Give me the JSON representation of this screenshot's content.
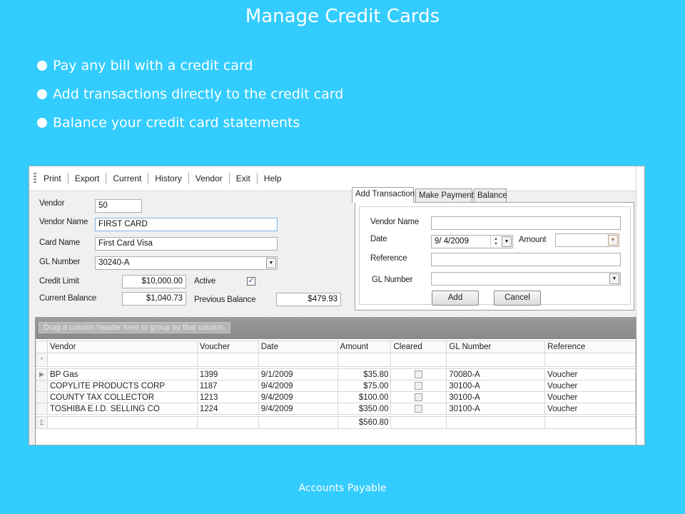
{
  "slide": {
    "title": "Manage Credit Cards",
    "bullets": [
      "Pay any bill with a credit card",
      "Add transactions directly to the credit card",
      "Balance your credit card statements"
    ],
    "footer": "Accounts Payable"
  },
  "menu": [
    "Print",
    "Export",
    "Current",
    "History",
    "Vendor",
    "Exit",
    "Help"
  ],
  "vendor_form": {
    "vendor_label": "Vendor",
    "vendor_value": "50",
    "vendor_name_label": "Vendor Name",
    "vendor_name_value": "FIRST CARD",
    "card_name_label": "Card Name",
    "card_name_value": "First Card Visa",
    "gl_number_label": "GL Number",
    "gl_number_value": "30240-A",
    "credit_limit_label": "Credit Limit",
    "credit_limit_value": "$10,000.00",
    "active_label": "Active",
    "active_checked": true,
    "active_mark": "✓",
    "current_balance_label": "Current Balance",
    "current_balance_value": "$1,040.73",
    "previous_balance_label": "Previous Balance",
    "previous_balance_value": "$479.93"
  },
  "tabs": [
    {
      "label": "Add Transaction",
      "active": true
    },
    {
      "label": "Make Payment",
      "active": false
    },
    {
      "label": "Balance",
      "active": false
    }
  ],
  "transaction_form": {
    "vendor_name_label": "Vendor Name",
    "vendor_name_value": "",
    "date_label": "Date",
    "date_value": "9/ 4/2009",
    "amount_label": "Amount",
    "amount_value": "",
    "reference_label": "Reference",
    "reference_value": "",
    "gl_number_label": "GL Number",
    "gl_number_value": "",
    "add_button": "Add",
    "cancel_button": "Cancel"
  },
  "grid": {
    "group_hint": "Drag a column header here to group by that column.",
    "columns": [
      "Vendor",
      "Voucher",
      "Date",
      "Amount",
      "Cleared",
      "GL Number",
      "Reference"
    ],
    "new_row_marker": "*",
    "rows": [
      {
        "vendor": "BP Gas",
        "voucher": "1399",
        "date": "9/1/2009",
        "amount": "$35.80",
        "cleared": false,
        "gl": "70080-A",
        "reference": "Voucher",
        "current": true
      },
      {
        "vendor": "COPYLITE PRODUCTS CORP",
        "voucher": "1187",
        "date": "9/4/2009",
        "amount": "$75.00",
        "cleared": false,
        "gl": "30100-A",
        "reference": "Voucher",
        "current": false
      },
      {
        "vendor": "COUNTY TAX COLLECTOR",
        "voucher": "1213",
        "date": "9/4/2009",
        "amount": "$100.00",
        "cleared": false,
        "gl": "30100-A",
        "reference": "Voucher",
        "current": false
      },
      {
        "vendor": "TOSHIBA E.I.D. SELLING CO",
        "voucher": "1224",
        "date": "9/4/2009",
        "amount": "$350.00",
        "cleared": false,
        "gl": "30100-A",
        "reference": "Voucher",
        "current": false
      }
    ],
    "summary_marker": "Σ",
    "summary_amount": "$560.80"
  }
}
